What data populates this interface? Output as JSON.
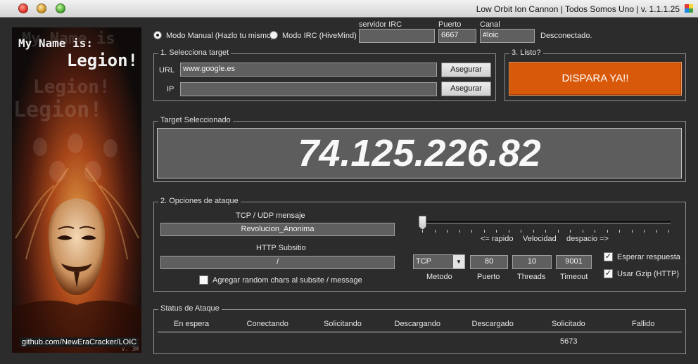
{
  "window": {
    "title": "Low Orbit Ion Cannon | Todos Somos Uno | v. 1.1.1.25"
  },
  "poster": {
    "line1": "My Name is:",
    "line2": "Legion!",
    "link": "github.com/NewEraCracker/LOIC",
    "version": "v. 3H"
  },
  "mode": {
    "manual_label": "Modo Manual (Hazlo tu mismo)",
    "irc_label": "Modo IRC (HiveMind)",
    "selected": "manual"
  },
  "irc": {
    "server_label": "servidor IRC",
    "server_value": "",
    "port_label": "Puerto",
    "port_value": "6667",
    "channel_label": "Canal",
    "channel_value": "#loic",
    "status": "Desconectado."
  },
  "target": {
    "group_title": "1. Selecciona target",
    "url_label": "URL",
    "url_value": "www.google.es",
    "url_button": "Asegurar",
    "ip_label": "IP",
    "ip_value": "",
    "ip_button": "Asegurar"
  },
  "ready": {
    "group_title": "3. Listo?",
    "fire_button": "DISPARA YA!!"
  },
  "selected_target": {
    "group_title": "Target Seleccionado",
    "ip": "74.125.226.82"
  },
  "attack": {
    "group_title": "2. Opciones de ataque",
    "tcp_udp_label": "TCP / UDP mensaje",
    "tcp_udp_value": "Revolucion_Anonima",
    "http_label": "HTTP Subsitio",
    "http_value": "/",
    "random_label": "Agregar random chars al subsite / message",
    "random_checked": false,
    "speed_fast": "<= rapido",
    "speed_label": "Velocidad",
    "speed_slow": "despacio =>",
    "speed_fraction": 0.0,
    "method_value": "TCP",
    "method_label": "Metodo",
    "port_value": "80",
    "port_label": "Puerto",
    "threads_value": "10",
    "threads_label": "Threads",
    "timeout_value": "9001",
    "timeout_label": "Timeout",
    "wait_label": "Esperar respuesta",
    "wait_checked": true,
    "gzip_label": "Usar Gzip (HTTP)",
    "gzip_checked": true
  },
  "status": {
    "group_title": "Status de Ataque",
    "columns": [
      "En espera",
      "Conectando",
      "Solicitando",
      "Descargando",
      "Descargado",
      "Solicitado",
      "Fallido"
    ],
    "values": [
      "",
      "",
      "",
      "",
      "",
      "5673",
      ""
    ]
  },
  "colors": {
    "fire": "#d9590a",
    "background": "#2c2c2c",
    "field": "#5f5f5f"
  }
}
